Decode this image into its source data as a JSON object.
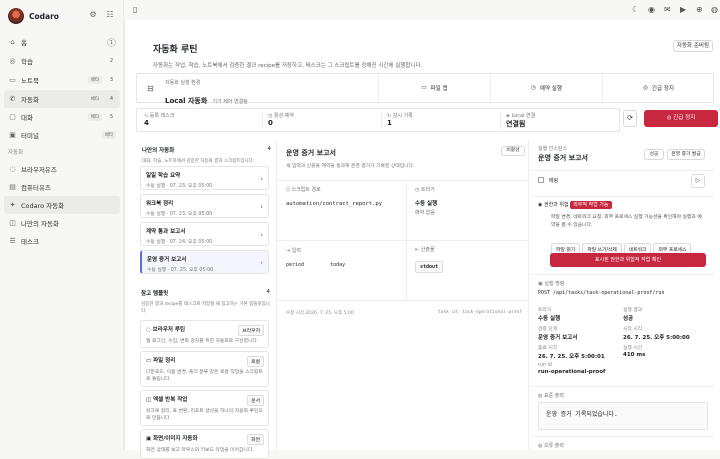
{
  "app": {
    "name": "Codaro"
  },
  "nav": {
    "items": [
      {
        "icon": "⌂",
        "label": "홈",
        "count": "1"
      },
      {
        "icon": "◎",
        "label": "학습",
        "count": "2"
      },
      {
        "icon": "▭",
        "label": "노트북",
        "tag": "베타",
        "count": "3"
      }
    ],
    "items2": [
      {
        "icon": "✆",
        "label": "자동화",
        "tag": "베타",
        "count": "4"
      },
      {
        "icon": "▢",
        "label": "대화",
        "tag": "베타",
        "count": "5"
      },
      {
        "icon": "▣",
        "label": "터미널",
        "tag": "베타"
      }
    ],
    "section": "자동화",
    "items3": [
      {
        "icon": "◌",
        "label": "브라우저유즈"
      },
      {
        "icon": "▤",
        "label": "컴퓨터유즈"
      },
      {
        "icon": "✦",
        "label": "Codaro 자동화"
      },
      {
        "icon": "◫",
        "label": "나만의 자동화"
      },
      {
        "icon": "☰",
        "label": "태스크"
      }
    ]
  },
  "page": {
    "title": "자동화 루틴",
    "subtitle": "자동화는 작업, 학습, 노트북에서 검증한 결과 recipe를 저장하고, 태스크는 그 스크립트를 정해진 시간에 실행합니다.",
    "ready_btn": "자동화 준비됨"
  },
  "env": {
    "label": "자동화 실행 환경",
    "value": "Local 자동화",
    "note": "기기 제어 연결됨",
    "actions": [
      {
        "icon": "▭",
        "label": "파일 캡"
      },
      {
        "icon": "◷",
        "label": "예약 실행"
      },
      {
        "icon": "◎",
        "label": "긴급 정지"
      }
    ]
  },
  "stats": [
    {
      "icon": "∿",
      "label": "등록 태스크",
      "value": "4"
    },
    {
      "icon": "◷",
      "label": "활성 예약",
      "value": "0"
    },
    {
      "icon": "↻",
      "label": "감시 기록",
      "value": "1"
    },
    {
      "icon": "◈",
      "label": "Local 연결",
      "value": "연결됨"
    }
  ],
  "stop_btn": "긴급 정지",
  "my": {
    "title": "나만의 자동화",
    "count": "4",
    "desc": "대화, 학습, 노트북에서 검증한 자동화 결과 스크립트입니다.",
    "items": [
      {
        "title": "일일 학습 요약",
        "meta": "수동 실행 · 07. 23. 오후 05:00"
      },
      {
        "title": "워크북 정리",
        "meta": "수동 실행 · 07. 23. 오후 05:00"
      },
      {
        "title": "계약 통과 보고서",
        "meta": "수동 실행 · 07. 24. 오후 05:00"
      },
      {
        "title": "운영 증거 보고서",
        "meta": "수동 실행 · 07. 25. 오후 05:00"
      }
    ]
  },
  "templates": {
    "title": "참고 템플릿",
    "count": "4",
    "desc": "검증한 결과 recipe를 태스크로 저장할 때 참고하는 기본 템플릿입니다.",
    "items": [
      {
        "icon": "◌",
        "title": "브라우저 루틴",
        "key": "브라우저",
        "desc": "웹 로그인, 수집, 변화 감지를 위한 자동화로 구성합니다."
      },
      {
        "icon": "▭",
        "title": "파일 정리",
        "key": "로컬",
        "desc": "다운로드, 이름 변경, 폴더 분류 같은 로컬 작업을 스크립트로 돌립니다."
      },
      {
        "icon": "◫",
        "title": "엑셀 반복 작업",
        "key": "문서",
        "desc": "워크북 정리, 표 변환, 리포트 생성을 하나의 자동화 루틴으로 만듭니다."
      },
      {
        "icon": "▣",
        "title": "화면/이미지 자동화",
        "key": "화면",
        "desc": "화면 상태를 보고 마우스와 키보드 작업을 이어갑니다."
      }
    ]
  },
  "detail": {
    "title": "운영 증거 보고서",
    "badge": "비활성",
    "desc": "새 입력과 산출물 계약을 통과해 운영 증거가 기록된 상태입니다.",
    "script_label": "스크립트 경로",
    "script": "automation/contract_report.py",
    "trigger_label": "트리거",
    "trigger": "수동 실행",
    "trigger_note": "예약 없음",
    "input_label": "입력",
    "input_k": "period",
    "input_v": "today",
    "output_label": "산출물",
    "output": "stdout",
    "created": "수정 시각 2026. 7. 25. 오후 5:00",
    "task_id": "task id: task-operational-proof"
  },
  "right": {
    "label": "실행 인스턴스",
    "title": "운영 증거 보고서",
    "ok": "성공",
    "issue": "운영 증거 발급",
    "run_label": "메링",
    "perm": {
      "label": "권한과 위험",
      "tag": "외부적 작업 가능",
      "desc": "파일 변경, 네트워크 요청, 외부 프로세스 실행 가능성을 확인해야 실행과 예약을 켤 수 있습니다.",
      "chips": [
        "파일 읽기",
        "파일 쓰기/삭제",
        "네트워크",
        "외부 프로세스"
      ],
      "confirm": "표시된 권한과 위험적 작업 확인"
    },
    "exec": {
      "label": "실행 명령",
      "cmd": "POST /api/tasks/task-operational-proof/run",
      "kv": [
        {
          "k": "트리거",
          "v": "수동 실행"
        },
        {
          "k": "실행 결과",
          "v": "성공"
        },
        {
          "k": "검증 단계",
          "v": "운영 증거 보고서"
        },
        {
          "k": "시작 시각",
          "v": "26. 7. 25. 오후 5:00:00"
        },
        {
          "k": "종료 시각",
          "v": "26. 7. 25. 오후 5:00:01"
        },
        {
          "k": "실행 시간",
          "v": "410 ms"
        }
      ],
      "run_id_label": "run id",
      "run_id": "run-operational-proof"
    },
    "stdout_label": "표준 출력",
    "stdout": "운영 증거 기록되었습니다.",
    "stderr_label": "오류 출력"
  }
}
